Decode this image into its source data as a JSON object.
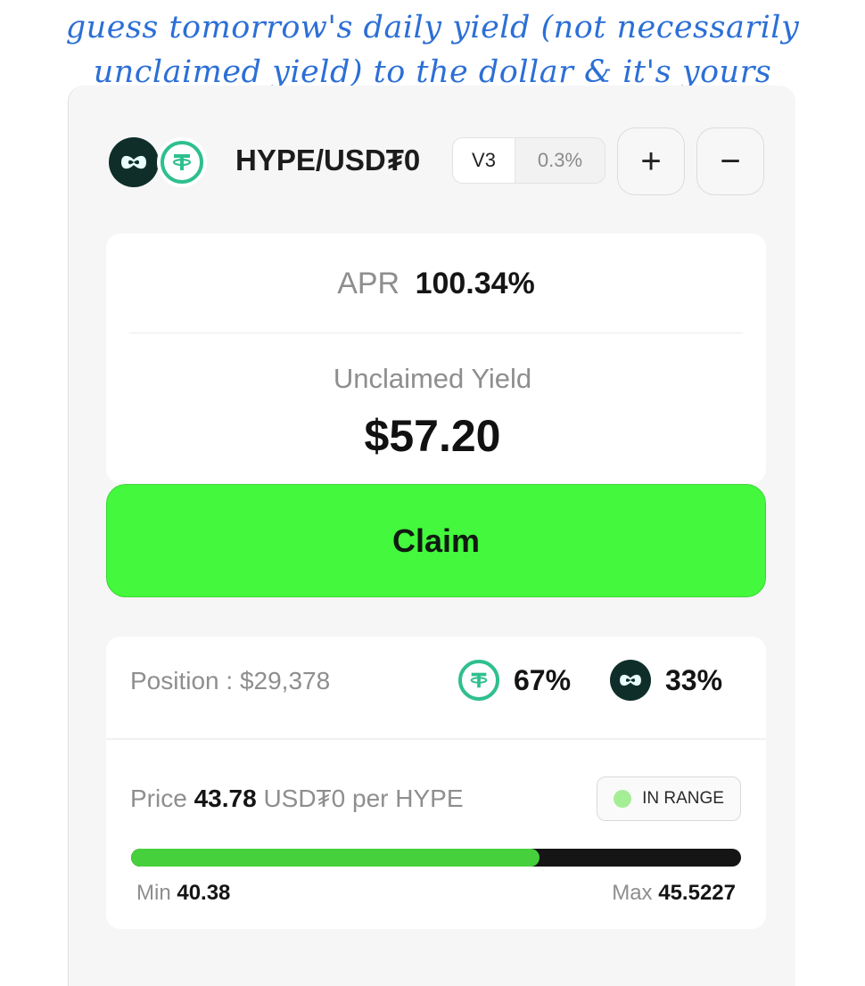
{
  "caption": {
    "line1": "guess tomorrow's daily yield (not necessarily",
    "line2": "unclaimed yield) to the dollar & it's yours"
  },
  "pool": {
    "pair": "HYPE/USD₮0",
    "version": "V3",
    "fee": "0.3%",
    "add_label": "+",
    "remove_label": "−",
    "token_icons": [
      "hype-logo-icon",
      "usdt0-logo-icon"
    ]
  },
  "stats": {
    "apr_label": "APR",
    "apr_value": "100.34%",
    "unclaimed_label": "Unclaimed Yield",
    "unclaimed_value": "$57.20",
    "claim_label": "Claim"
  },
  "position": {
    "label": "Position : $29,378",
    "usdt_pct": "67%",
    "hype_pct": "33%",
    "price_prefix": "Price",
    "price_value": "43.78",
    "price_suffix": "USD₮0 per HYPE",
    "status": "IN RANGE",
    "min_label": "Min",
    "min_value": "40.38",
    "max_label": "Max",
    "max_value": "45.5227",
    "range_fill_fraction": 0.67
  },
  "colors": {
    "accent_green": "#44f83d",
    "in_range_dot": "#a6ee96",
    "usdt_teal": "#2fbf8f",
    "hype_dark": "#0f2e2a",
    "caption_blue": "#2c6fd6"
  }
}
